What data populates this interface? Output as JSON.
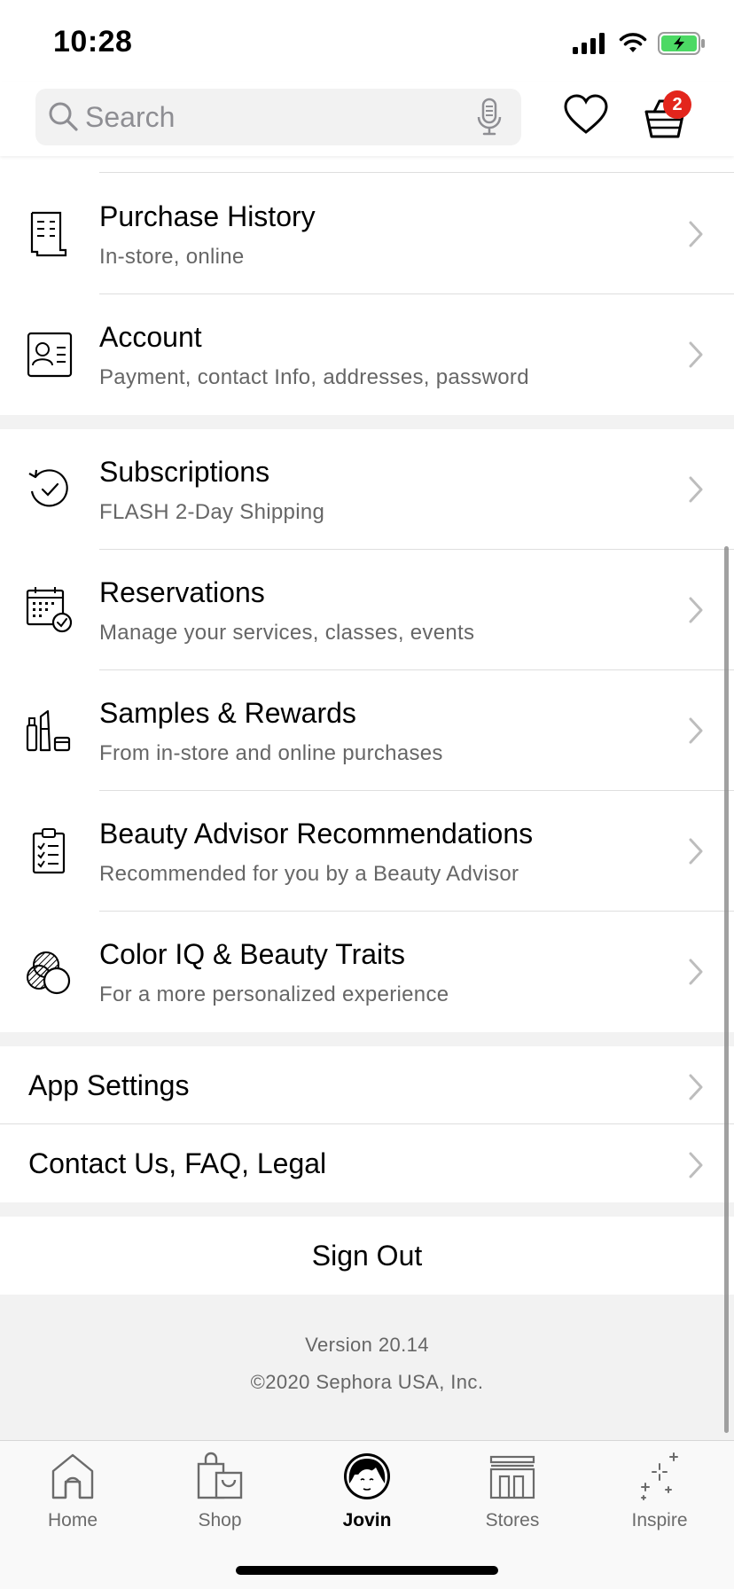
{
  "status_bar": {
    "time": "10:28"
  },
  "search": {
    "placeholder": "Search"
  },
  "basket": {
    "count": "2"
  },
  "account_rows": [
    {
      "title": "Purchase History",
      "subtitle": "In-store, online",
      "icon": "receipt-icon"
    },
    {
      "title": "Account",
      "subtitle": "Payment, contact Info, addresses, password",
      "icon": "id-card-icon"
    }
  ],
  "feature_rows": [
    {
      "title": "Subscriptions",
      "subtitle": "FLASH 2-Day Shipping",
      "icon": "refresh-check-icon"
    },
    {
      "title": "Reservations",
      "subtitle": "Manage your services, classes, events",
      "icon": "calendar-check-icon"
    },
    {
      "title": "Samples & Rewards",
      "subtitle": "From in-store and online purchases",
      "icon": "products-icon"
    },
    {
      "title": "Beauty Advisor Recommendations",
      "subtitle": "Recommended for you by a Beauty Advisor",
      "icon": "clipboard-icon"
    },
    {
      "title": "Color IQ & Beauty Traits",
      "subtitle": "For a more personalized experience",
      "icon": "color-swatch-icon"
    }
  ],
  "settings_rows": [
    {
      "title": "App Settings"
    },
    {
      "title": "Contact Us, FAQ, Legal"
    }
  ],
  "sign_out": "Sign Out",
  "footer": {
    "version": "Version 20.14",
    "copyright": "©2020 Sephora USA, Inc."
  },
  "tabs": [
    {
      "label": "Home",
      "icon": "home-icon",
      "active": false
    },
    {
      "label": "Shop",
      "icon": "shopping-bag-icon",
      "active": false
    },
    {
      "label": "Jovin",
      "icon": "avatar-icon",
      "active": true
    },
    {
      "label": "Stores",
      "icon": "store-icon",
      "active": false
    },
    {
      "label": "Inspire",
      "icon": "sparkle-icon",
      "active": false
    }
  ],
  "colors": {
    "badge": "#e3251c",
    "battery": "#4cd964",
    "section_gap": "#f2f2f2"
  }
}
